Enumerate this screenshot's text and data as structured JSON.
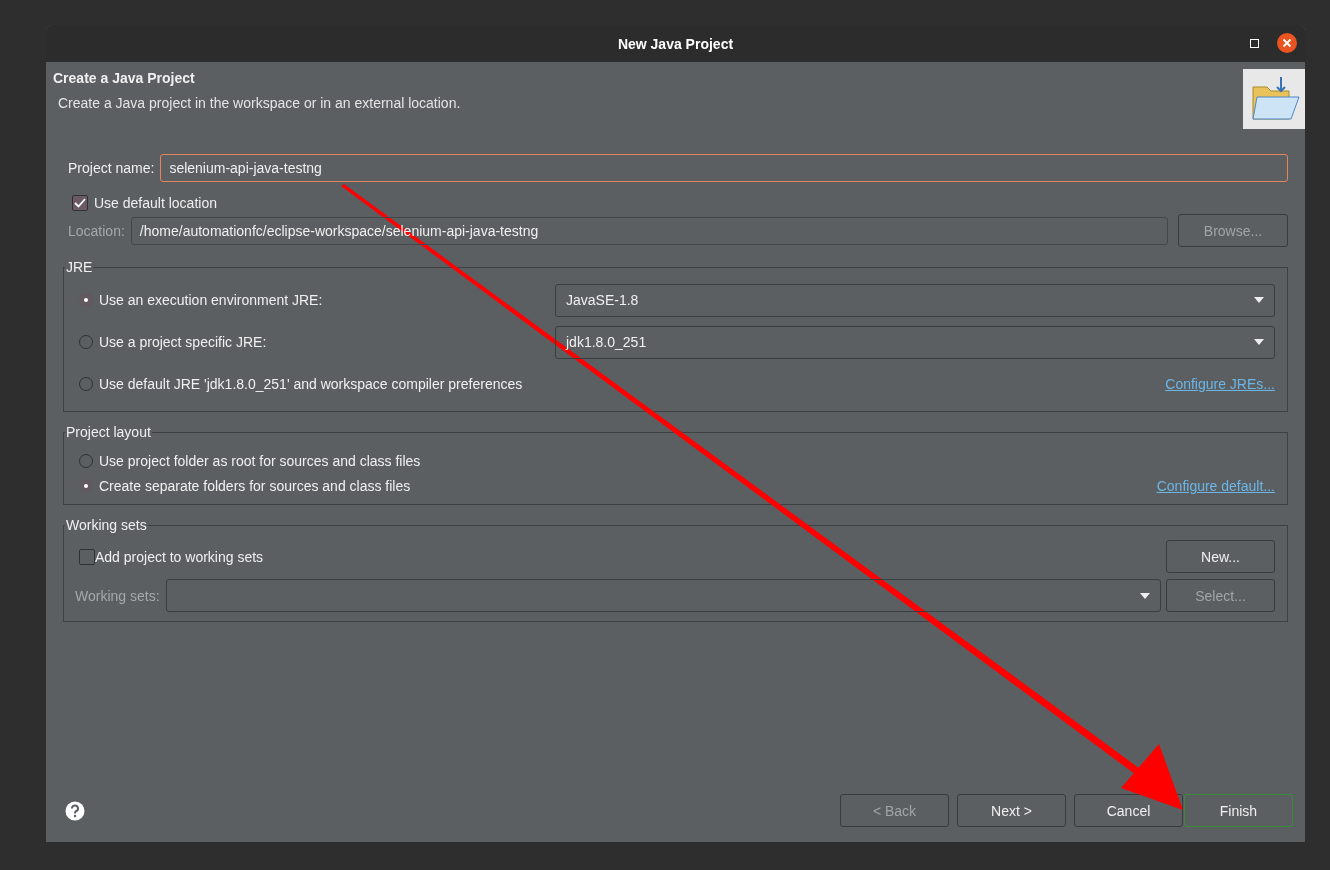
{
  "window": {
    "title": "New Java Project"
  },
  "header": {
    "title": "Create a Java Project",
    "description": "Create a Java project in the workspace or in an external location."
  },
  "project_name": {
    "label": "Project name:",
    "value": "selenium-api-java-testng"
  },
  "use_default_location": {
    "label": "Use default location",
    "checked": true
  },
  "location": {
    "label": "Location:",
    "value": "/home/automationfc/eclipse-workspace/selenium-api-java-testng",
    "disabled": true
  },
  "browse_button": {
    "label": "Browse...",
    "disabled": true
  },
  "jre": {
    "title": "JRE",
    "options": [
      {
        "label": "Use an execution environment JRE:",
        "selected": true,
        "kind": "combo",
        "value": "JavaSE-1.8"
      },
      {
        "label": "Use a project specific JRE:",
        "selected": false,
        "kind": "combo",
        "value": "jdk1.8.0_251"
      },
      {
        "label": "Use default JRE 'jdk1.8.0_251' and workspace compiler preferences",
        "selected": false,
        "kind": "link",
        "link": "Configure JREs..."
      }
    ]
  },
  "project_layout": {
    "title": "Project layout",
    "options": [
      {
        "label": "Use project folder as root for sources and class files",
        "selected": false
      },
      {
        "label": "Create separate folders for sources and class files",
        "selected": true
      }
    ],
    "link": "Configure default..."
  },
  "working_sets": {
    "title": "Working sets",
    "add": {
      "label": "Add project to working sets",
      "checked": false
    },
    "new_button": "New...",
    "field_label": "Working sets:",
    "select_button": {
      "label": "Select...",
      "disabled": true
    }
  },
  "buttons": [
    {
      "label": "< Back",
      "disabled": true,
      "default": false
    },
    {
      "label": "Next >",
      "disabled": false,
      "default": false
    },
    {
      "label": "Cancel",
      "disabled": false,
      "default": false
    },
    {
      "label": "Finish",
      "disabled": false,
      "default": true
    }
  ]
}
